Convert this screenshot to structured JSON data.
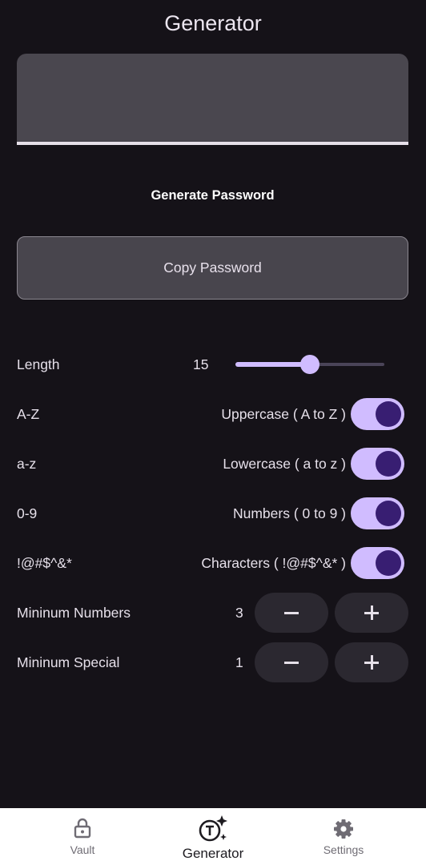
{
  "header": {
    "title": "Generator"
  },
  "password_field": {
    "value": ""
  },
  "actions": {
    "generate_label": "Generate Password",
    "copy_label": "Copy Password"
  },
  "length": {
    "label": "Length",
    "value": "15",
    "min": 0,
    "max": 30,
    "fraction": 0.5
  },
  "toggles": [
    {
      "label": "A-Z",
      "description": "Uppercase ( A to Z )",
      "on": true
    },
    {
      "label": "a-z",
      "description": "Lowercase ( a to z )",
      "on": true
    },
    {
      "label": "0-9",
      "description": "Numbers ( 0 to 9 )",
      "on": true
    },
    {
      "label": "!@#$^&*",
      "description": "Characters ( !@#$^&* )",
      "on": true
    }
  ],
  "min_numbers": {
    "label": "Mininum Numbers",
    "value": "3"
  },
  "min_special": {
    "label": "Mininum Special",
    "value": "1"
  },
  "colors": {
    "background": "#151218",
    "accent": "#d0bcff",
    "switch_knob": "#381e72"
  },
  "nav": {
    "items": [
      {
        "label": "Vault",
        "icon": "lock-icon",
        "active": false
      },
      {
        "label": "Generator",
        "icon": "generator-icon",
        "active": true
      },
      {
        "label": "Settings",
        "icon": "gear-icon",
        "active": false
      }
    ]
  }
}
